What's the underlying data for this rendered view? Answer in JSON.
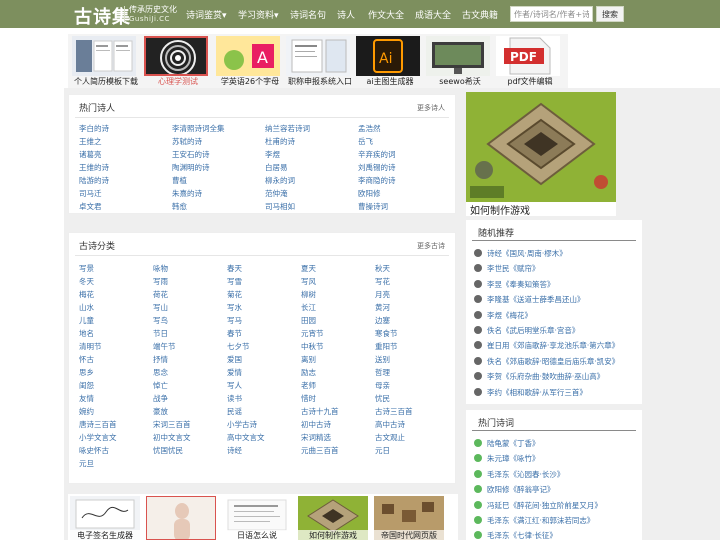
{
  "header": {
    "logo": "古诗集",
    "tagline": "传承历史文化",
    "domain": "GushiJi.CC",
    "nav": [
      "诗词鉴赏▾",
      "学习资料▾",
      "诗词名句",
      "诗人",
      "作文大全",
      "成语大全",
      "古文典籍"
    ],
    "search_placeholder": "作者/诗词名/作者+诗词名",
    "search_button": "搜索"
  },
  "ads": [
    "个人简历模板下载",
    "心理学测试",
    "学英语26个字母",
    "职称申报系统入口",
    "ai主图生成器",
    "seewo希沃",
    "pdf文件编辑"
  ],
  "poets_panel": {
    "title": "热门诗人",
    "more": "更多诗人",
    "items": [
      "李白的诗",
      "李清照诗词全集",
      "纳兰容若诗词",
      "孟浩然",
      "王维之",
      "苏轼的诗",
      "杜甫的诗",
      "岳飞",
      "诸葛亮",
      "王安石的诗",
      "李煜",
      "辛弃疾的词",
      "王维的诗",
      "陶渊明的诗",
      "白居易",
      "刘禹锡的诗",
      "陆游的诗",
      "曹植",
      "柳永的词",
      "李商隐的诗",
      "司马迁",
      "朱熹的诗",
      "范仲淹",
      "欧阳修",
      "卓文君",
      "韩愈",
      "司马相如",
      "曹操诗词"
    ]
  },
  "categories_panel": {
    "title": "古诗分类",
    "more": "更多古诗",
    "items": [
      "写景",
      "咏物",
      "春天",
      "夏天",
      "秋天",
      "冬天",
      "写雨",
      "写雪",
      "写风",
      "写花",
      "梅花",
      "荷花",
      "菊花",
      "柳树",
      "月亮",
      "山水",
      "写山",
      "写水",
      "长江",
      "黄河",
      "儿童",
      "写鸟",
      "写马",
      "田园",
      "边塞",
      "地名",
      "节日",
      "春节",
      "元宵节",
      "寒食节",
      "清明节",
      "端午节",
      "七夕节",
      "中秋节",
      "重阳节",
      "怀古",
      "抒情",
      "爱国",
      "离别",
      "送别",
      "思乡",
      "思念",
      "爱情",
      "励志",
      "哲理",
      "闺怨",
      "悼亡",
      "写人",
      "老师",
      "母亲",
      "友情",
      "战争",
      "读书",
      "惜时",
      "忧民",
      "婉约",
      "豪放",
      "民谣",
      "古诗十九首",
      "古诗三百首",
      "唐诗三百首",
      "宋词三百首",
      "小学古诗",
      "初中古诗",
      "高中古诗",
      "小学文言文",
      "初中文言文",
      "高中文言文",
      "宋词精选",
      "古文观止",
      "咏史怀古",
      "忧国忧民",
      "诗经",
      "元曲三百首",
      "元日",
      "元旦"
    ]
  },
  "game": {
    "title": "如何制作游戏"
  },
  "random_panel": {
    "title": "随机推荐",
    "items": [
      "诗经《国风·周南·樛木》",
      "李世民《赋帘》",
      "李昱《奉奏知策答》",
      "李隆基《送道士薛季昌还山》",
      "李煜《梅花》",
      "佚名《武后明堂乐章·宫音》",
      "崔日用《郊庙歌辞·享龙池乐章·第六章》",
      "佚名《郊庙歌辞·昭德皇后庙乐章·凯安》",
      "李贺《乐府杂曲·鼓吹曲辞·巫山高》",
      "李约《相和歌辞·从军行三首》"
    ]
  },
  "hot_panel": {
    "title": "热门诗词",
    "items": [
      "陆龟蒙《丁香》",
      "朱元璋《咏竹》",
      "毛泽东《沁园春·长沙》",
      "欧阳修《醉翁亭记》",
      "冯延巳《醉花间·独立阶前星又月》",
      "毛泽东《满江红·和郭沫若同志》",
      "毛泽东《七律·长征》"
    ]
  },
  "bottom_ads": [
    "电子签名生成器",
    "",
    "日语怎么说",
    "如何制作游戏",
    "帝国时代网页版"
  ]
}
